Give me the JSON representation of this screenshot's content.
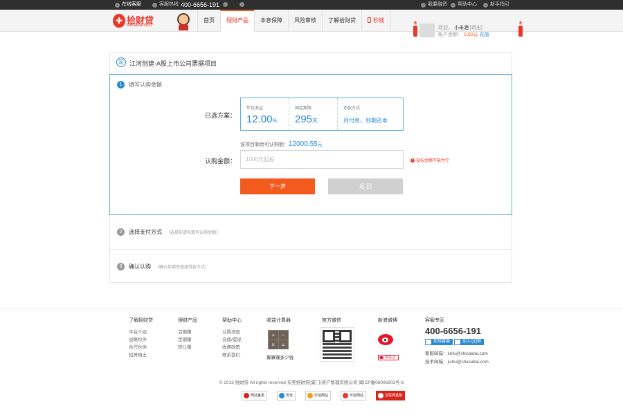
{
  "topbar": {
    "online_service": "在线客服",
    "hotline_label": "客服热线",
    "hotline_number": "400-6656-191",
    "wealth_label": "我要融资",
    "help_label": "帮助中心",
    "guide_label": "新手指引"
  },
  "logo": {
    "name": "拾财贷",
    "domain": "shicaidai.com",
    "brand_color": "#e8382a"
  },
  "nav": {
    "tabs": [
      {
        "label": "首页"
      },
      {
        "label": "理财产品",
        "active": true
      },
      {
        "label": "本息保障"
      },
      {
        "label": "风险审核"
      },
      {
        "label": "了解拾财贷"
      },
      {
        "label": "秒钱"
      }
    ]
  },
  "user": {
    "welcome": "欢迎，",
    "username": "小米酒",
    "logout": "[退出]",
    "balance_label": "账户余额：",
    "balance": "0.00元",
    "recharge": "充值"
  },
  "project": {
    "badge": "定",
    "title": "江河创建-A股上市公司票据项目"
  },
  "step1": {
    "num": "1",
    "title": "填写认购金额",
    "plan_label": "已选方案：",
    "plan": [
      {
        "key": "年化收益",
        "value": "12.00",
        "unit": "%"
      },
      {
        "key": "固定期限",
        "value": "295",
        "unit": "天"
      },
      {
        "key": "还款方式",
        "value": "月付息，到期还本"
      }
    ],
    "remain_label": "该项目剩余可认购额：",
    "remain_value": "12000.55",
    "remain_unit": "元",
    "amount_label": "认购金额：",
    "amount_placeholder": "1000元起投",
    "amount_value": "",
    "error": "投标金额不能为空",
    "next_button": "下一步",
    "back_button": "返 回"
  },
  "step2": {
    "num": "2",
    "title": "选择支付方式",
    "hint": "（选择前请先填写认购金额）"
  },
  "step3": {
    "num": "3",
    "title": "确认认购",
    "hint": "（确认前请先选择付款方式）"
  },
  "footer": {
    "about": {
      "title": "了解拾财贷",
      "items": [
        "平台介绍",
        "战略伙伴",
        "合作伙伴",
        "招贤纳士"
      ]
    },
    "products": {
      "title": "理财产品",
      "items": [
        "活期赚",
        "定期赚",
        "转让赚"
      ]
    },
    "help": {
      "title": "帮助中心",
      "items": [
        "认购流程",
        "充值/提现",
        "收费政策",
        "联系我们"
      ]
    },
    "calculator": {
      "title": "收益计算器",
      "caption": "算算赚多少钱",
      "keys": [
        "+",
        "−",
        "×",
        "="
      ]
    },
    "wechat": {
      "title": "官方微信"
    },
    "weibo": {
      "title": "新浪微博",
      "follow": "加关注"
    },
    "service": {
      "title": "客服专区",
      "phone": "400-6656-191",
      "online_btn": "在线客服",
      "qq_btn": "加入QQ群",
      "email_label": "客服邮箱：",
      "email": "kefu@shicaidai.com",
      "tech_label": "技术邮箱：",
      "tech_email": "jishu@shicaidai.com"
    },
    "copyright": "© 2013 拾财贷 All rights reserved 东莞拾财贷(厦门)资产管理有限公司 闽ICP备08006903号-6",
    "badges": [
      {
        "label": "网站备案",
        "color": "#d8261e"
      },
      {
        "label": "安全",
        "color": "#2a8bd4"
      },
      {
        "label": "可信网站",
        "color": "#e8a21e"
      },
      {
        "label": "可信网站",
        "color": "#e8382a"
      },
      {
        "label": "互联网金融",
        "color": "#ffffff"
      }
    ]
  }
}
